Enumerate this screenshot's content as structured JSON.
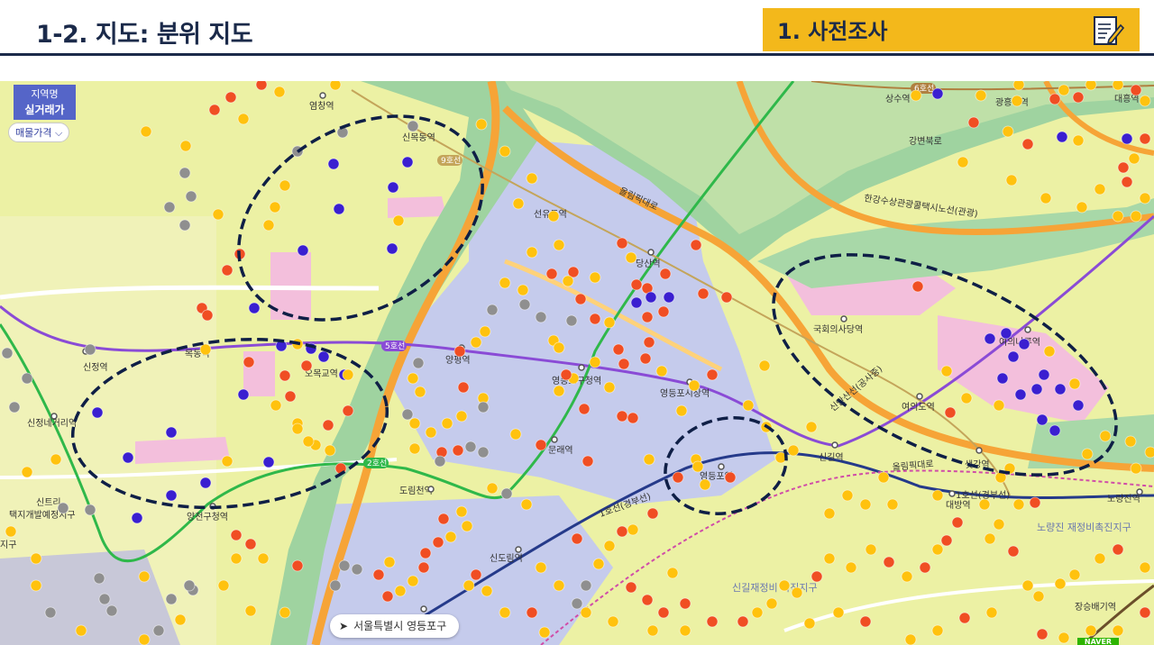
{
  "header": {
    "slide_title": "1-2. 지도: 분위 지도",
    "section_title": "1. 사전조사",
    "section_icon": "document-pen-icon"
  },
  "legend": {
    "region_label": "지역명",
    "trade_label": "실거래가",
    "price_label": "매물가격"
  },
  "location": {
    "text": "서울특별시 영등포구",
    "icon": "navigation-arrow-icon"
  },
  "brand": "NAVER",
  "colors": {
    "header_accent": "#f3b81b",
    "header_text": "#1b2a4a",
    "dot_red": "#f04e23",
    "dot_orange": "#ffc20e",
    "dot_blue": "#3a1fd0",
    "dot_gray": "#8f8f8f",
    "cluster_outline": "#0f1f46",
    "line5": "#8a4bd6",
    "line2": "#2fb84a",
    "line1": "#253a8a"
  },
  "map": {
    "place_labels": [
      {
        "id": "yeomchang",
        "text": "염창역"
      },
      {
        "id": "sinmokdong",
        "text": "신목동역"
      },
      {
        "id": "seonyudo",
        "text": "선유도역"
      },
      {
        "id": "dangsan",
        "text": "당산역"
      },
      {
        "id": "omokgyo",
        "text": "오목교역"
      },
      {
        "id": "mokdong",
        "text": "목동역"
      },
      {
        "id": "sinjeong",
        "text": "신정역"
      },
      {
        "id": "sinjeongnegeori",
        "text": "신정네거리역"
      },
      {
        "id": "yangpyeong",
        "text": "양평역"
      },
      {
        "id": "ydpgucheong",
        "text": "영등포구청역"
      },
      {
        "id": "ydpsijang",
        "text": "영등포시장역"
      },
      {
        "id": "mullae",
        "text": "문래역"
      },
      {
        "id": "dorimcheon",
        "text": "도림천역"
      },
      {
        "id": "yangcheongucheong",
        "text": "양천구청역"
      },
      {
        "id": "sindorim",
        "text": "신도림역"
      },
      {
        "id": "yeongdeungpo",
        "text": "영등포역"
      },
      {
        "id": "singil",
        "text": "신길역"
      },
      {
        "id": "gukhoe",
        "text": "국회의사당역"
      },
      {
        "id": "yeouinaru",
        "text": "여의나루역"
      },
      {
        "id": "yeouido",
        "text": "여의도역"
      },
      {
        "id": "saetgang",
        "text": "샛강역"
      },
      {
        "id": "daebang",
        "text": "대방역"
      },
      {
        "id": "noryangjin",
        "text": "노량진역"
      },
      {
        "id": "sangsu",
        "text": "상수역"
      },
      {
        "id": "gwangheungchang",
        "text": "광흥창역"
      },
      {
        "id": "daeheung",
        "text": "대흥역"
      },
      {
        "id": "jangseungbaegi",
        "text": "장승배기역"
      },
      {
        "id": "sinwolbu",
        "text": "신트리"
      },
      {
        "id": "taekji",
        "text": "택지개발예정지구"
      },
      {
        "id": "gangbyeon",
        "text": "강변북로"
      },
      {
        "id": "hangang",
        "text": "한강수상관광콜택시노선(관광)"
      },
      {
        "id": "olympic1",
        "text": "올림픽대로"
      },
      {
        "id": "olympic2",
        "text": "올림픽대로"
      },
      {
        "id": "line1",
        "text": "1호선(경부선)"
      },
      {
        "id": "line1b",
        "text": "1호선(경부선)"
      },
      {
        "id": "sinanline",
        "text": "신안산선(공사중)"
      },
      {
        "id": "noryangjin_dist",
        "text": "노량진 재정비촉진지구"
      },
      {
        "id": "singil_dist",
        "text": "신길재정비 촉진지구"
      },
      {
        "id": "jigu",
        "text": "지구"
      }
    ],
    "line_labels": {
      "line5": "5호선",
      "line2": "2호선",
      "line9": "9호선",
      "line6": "6호선"
    }
  }
}
